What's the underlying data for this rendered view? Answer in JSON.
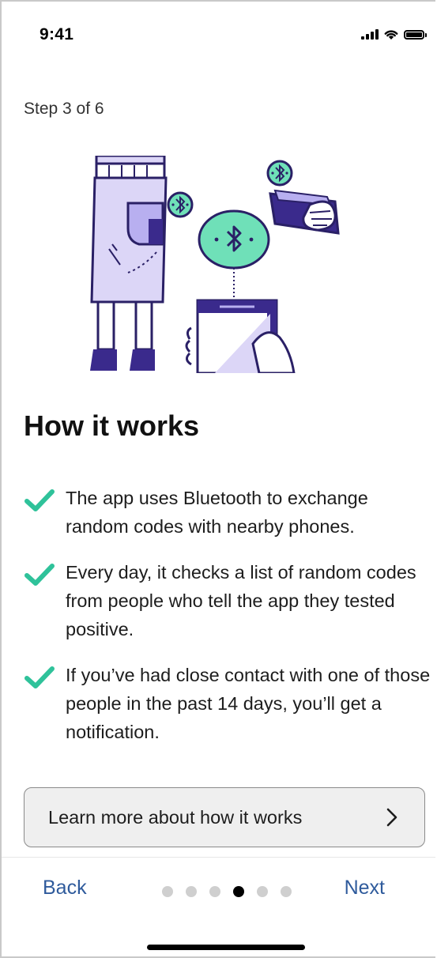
{
  "status_bar": {
    "time": "9:41",
    "icons": [
      "cellular-signal-icon",
      "wifi-icon",
      "battery-icon"
    ]
  },
  "step_label": "Step 3 of 6",
  "illustration": {
    "icon": "bluetooth-exchange-illustration",
    "colors": {
      "purple": "#3a2a8c",
      "lavender": "#dcd6f7",
      "mint": "#6fe0b8"
    }
  },
  "title": "How it works",
  "bullets": [
    {
      "icon": "checkmark-icon",
      "text": "The app uses Bluetooth to exchange random codes with nearby phones."
    },
    {
      "icon": "checkmark-icon",
      "text": "Every day, it checks a list of random codes from people who tell the app they tested positive."
    },
    {
      "icon": "checkmark-icon",
      "text": "If you’ve had close contact with one of those people in the past 14 days, you’ll get a notification."
    }
  ],
  "learn_more": {
    "label": "Learn more about how it works",
    "icon": "chevron-right-icon"
  },
  "footer": {
    "back_label": "Back",
    "next_label": "Next",
    "pagination": {
      "total": 6,
      "current": 4
    }
  },
  "colors": {
    "check": "#2fc29a",
    "link": "#2f5b9c",
    "dot_inactive": "#cfcfcf",
    "dot_active": "#000000"
  }
}
